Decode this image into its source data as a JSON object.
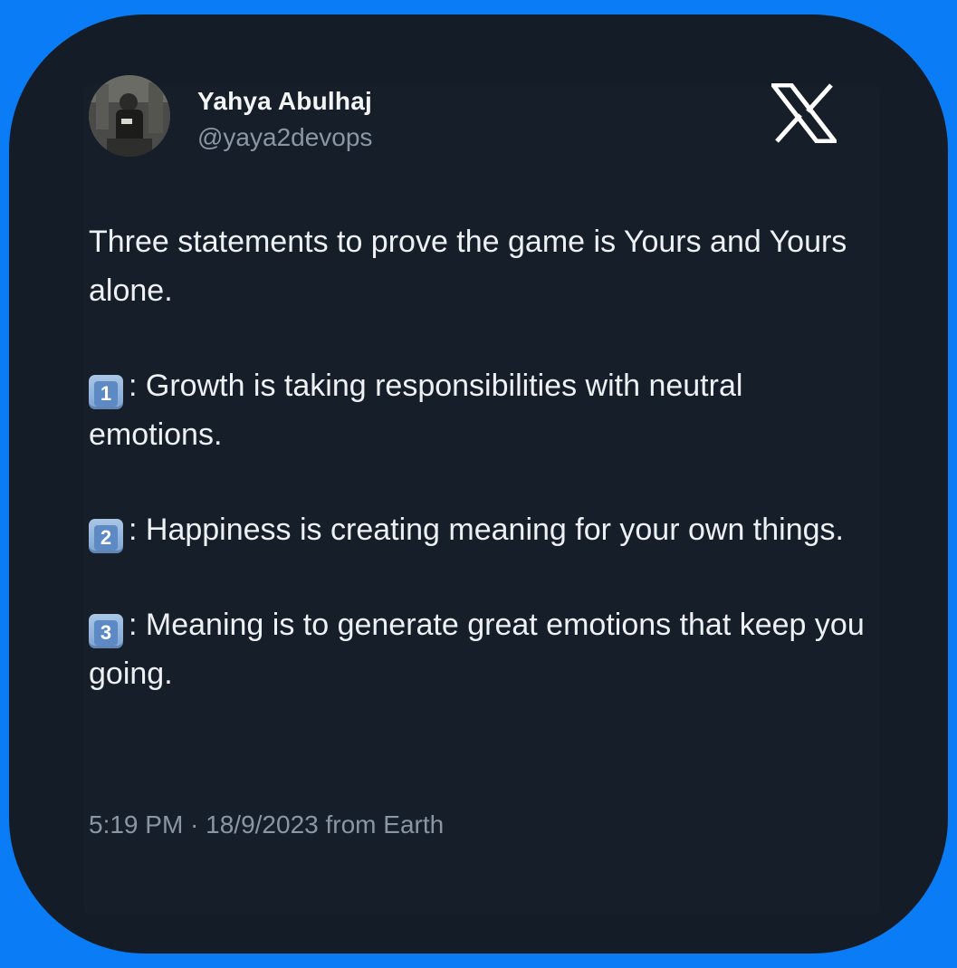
{
  "author": {
    "name": "Yahya Abulhaj",
    "handle": "@yaya2devops"
  },
  "icons": {
    "platform": "x-logo-icon",
    "avatar": "avatar-photo"
  },
  "tweet": {
    "intro": "Three statements to prove the game is Yours and Yours alone.",
    "points": [
      {
        "number": "1",
        "text": ": Growth is taking responsibilities with neutral emotions."
      },
      {
        "number": "2",
        "text": ": Happiness is creating meaning for your own things."
      },
      {
        "number": "3",
        "text": ": Meaning is to generate great emotions that keep you going."
      }
    ]
  },
  "timestamp": "5:19 PM · 18/9/2023 from Earth",
  "colors": {
    "page_background": "#0a7cf5",
    "card_background": "#141d27",
    "primary_text": "#eef1f4",
    "secondary_text": "#8a96a3"
  }
}
